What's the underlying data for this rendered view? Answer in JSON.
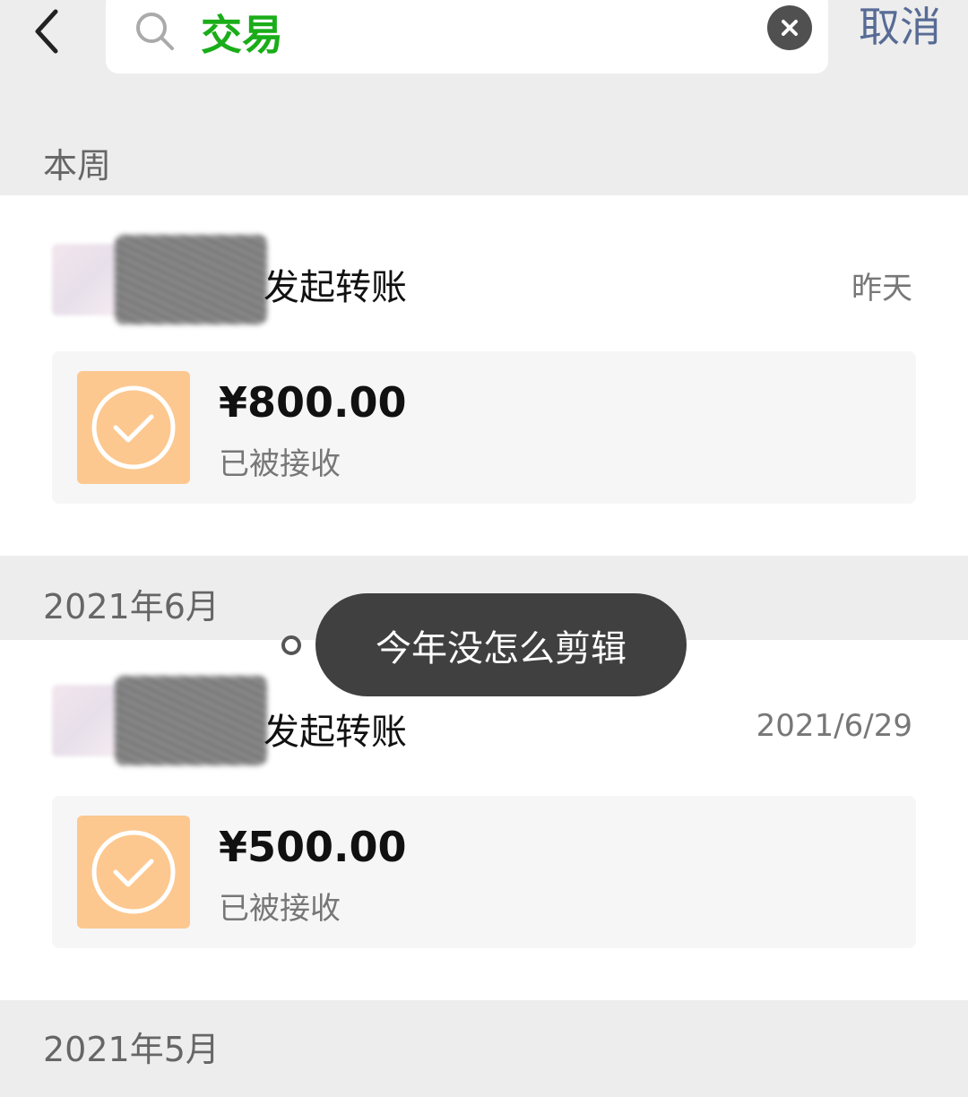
{
  "header": {
    "search_value": "交易",
    "cancel_label": "取消"
  },
  "sections": [
    {
      "label": "本周",
      "items": [
        {
          "title": "发起转账",
          "date": "昨天",
          "amount": "¥800.00",
          "status": "已被接收"
        }
      ]
    },
    {
      "label": "2021年6月",
      "items": [
        {
          "title": "发起转账",
          "date": "2021/6/29",
          "amount": "¥500.00",
          "status": "已被接收"
        }
      ]
    },
    {
      "label": "2021年5月",
      "items": []
    }
  ],
  "toast": {
    "text": "今年没怎么剪辑"
  },
  "colors": {
    "accent_green": "#1aad19",
    "link_blue": "#576b95",
    "status_orange": "#fcc88f"
  },
  "icons": [
    "back-arrow-icon",
    "search-icon",
    "clear-icon",
    "check-circle-icon"
  ]
}
